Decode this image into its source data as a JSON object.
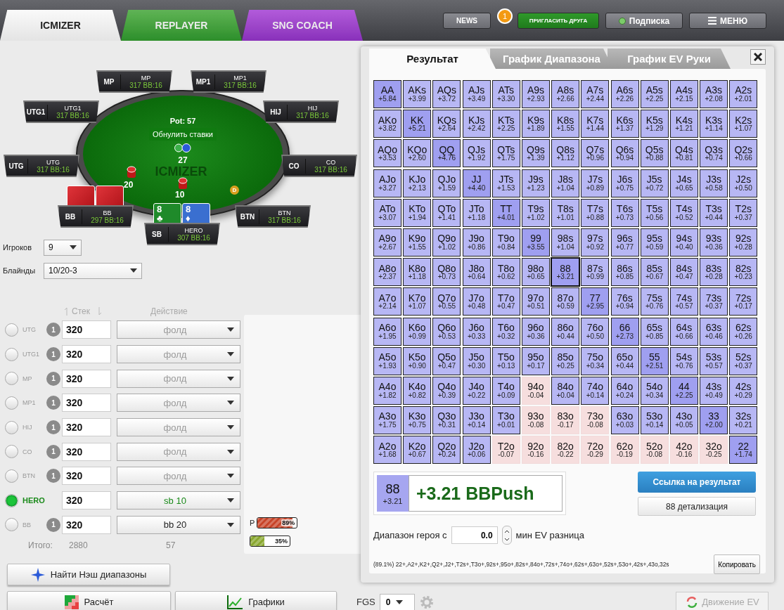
{
  "app_tabs": [
    {
      "label": "ICMIZER",
      "kind": "icmizer",
      "selected": true
    },
    {
      "label": "REPLAYER",
      "kind": "replayer",
      "selected": false
    },
    {
      "label": "SNG COACH",
      "kind": "coach",
      "selected": false
    }
  ],
  "top_buttons": [
    {
      "label": "NEWS",
      "kind": "plain"
    },
    {
      "label": "ПРИГЛАСИТЬ ДРУГА",
      "kind": "invite",
      "badge": "1"
    },
    {
      "label": "Подписка",
      "kind": "subscription"
    },
    {
      "label": "МЕНЮ",
      "kind": "menu"
    }
  ],
  "table": {
    "watermark": "ICMIZER",
    "pot": "Pot: 57",
    "reset_button": "Обнулить ставки",
    "pot_chips": "27",
    "dealer": "D",
    "seats": [
      {
        "position": "MP",
        "name": "MP",
        "stack": "317",
        "bb": "BB:16"
      },
      {
        "position": "MP1",
        "name": "MP1",
        "stack": "317",
        "bb": "BB:16"
      },
      {
        "position": "UTG1",
        "name": "UTG1",
        "stack": "317",
        "bb": "BB:16"
      },
      {
        "position": "HIJ",
        "name": "HIJ",
        "stack": "317",
        "bb": "BB:16"
      },
      {
        "position": "UTG",
        "name": "UTG",
        "stack": "317",
        "bb": "BB:16"
      },
      {
        "position": "CO",
        "name": "CO",
        "stack": "317",
        "bb": "BB:16"
      },
      {
        "position": "BB",
        "name": "BB",
        "stack": "297",
        "bb": "BB:16",
        "cards": [
          {
            "face_down": true
          },
          {
            "face_down": true
          }
        ],
        "bet": "20"
      },
      {
        "position": "SB",
        "name": "HERO",
        "stack": "307",
        "bb": "BB:16",
        "cards": [
          {
            "face_down": false,
            "rank": "8",
            "suit": "♣",
            "color": "#1f8a2a"
          },
          {
            "face_down": false,
            "rank": "8",
            "suit": "♦",
            "color": "#3a6fd0"
          }
        ],
        "bet": "10"
      },
      {
        "position": "BTN",
        "name": "BTN",
        "stack": "317",
        "bb": "BB:16"
      }
    ]
  },
  "settings": [
    {
      "label": "Игроков",
      "value": "9",
      "kind": "short"
    },
    {
      "label": "Блайнды",
      "value": "10/20-3",
      "kind": "wide"
    }
  ],
  "players_header": {
    "stack": "Стек",
    "action": "Действие"
  },
  "players": [
    {
      "position": "UTG",
      "selected": false,
      "count": "1",
      "stack": "320",
      "action": "фолд",
      "kind": "fold"
    },
    {
      "position": "UTG1",
      "selected": false,
      "count": "1",
      "stack": "320",
      "action": "фолд",
      "kind": "fold"
    },
    {
      "position": "MP",
      "selected": false,
      "count": "1",
      "stack": "320",
      "action": "фолд",
      "kind": "fold"
    },
    {
      "position": "MP1",
      "selected": false,
      "count": "1",
      "stack": "320",
      "action": "фолд",
      "kind": "fold"
    },
    {
      "position": "HIJ",
      "selected": false,
      "count": "1",
      "stack": "320",
      "action": "фолд",
      "kind": "fold"
    },
    {
      "position": "CO",
      "selected": false,
      "count": "1",
      "stack": "320",
      "action": "фолд",
      "kind": "fold"
    },
    {
      "position": "BTN",
      "selected": false,
      "count": "1",
      "stack": "320",
      "action": "фолд",
      "kind": "fold"
    },
    {
      "position": "HERO",
      "selected": true,
      "stack": "320",
      "action": "sb 10",
      "kind": "sb"
    },
    {
      "position": "BB",
      "selected": false,
      "count": "1",
      "stack": "320",
      "action": "bb 20",
      "kind": "bb"
    }
  ],
  "totals": {
    "label": "Итого:",
    "stack": "2880",
    "pot": "57"
  },
  "meters": [
    {
      "label": "P",
      "reading": "89%",
      "level": 0.89,
      "color": "#c8452a"
    },
    {
      "reading": "35%",
      "level": 0.35,
      "color": "#8aa830"
    }
  ],
  "nash_button": "Найти Нэш диапазоны",
  "bottom": {
    "calc": "Расчёт",
    "charts": "Графики",
    "fgs_label": "FGS",
    "fgs_value": "0",
    "ev_button": "Движение EV",
    "ev_disabled": true
  },
  "popup": {
    "tabs": [
      {
        "label": "Результат",
        "selected": true
      },
      {
        "label": "График Диапазона",
        "selected": false
      },
      {
        "label": "График EV Руки",
        "selected": false
      }
    ],
    "grid": [
      [
        {
          "hand": "AA",
          "ev": "+5.84",
          "push": true,
          "selected": false
        },
        {
          "hand": "AKs",
          "ev": "+3.99",
          "push": true,
          "selected": false
        },
        {
          "hand": "AQs",
          "ev": "+3.72",
          "push": true,
          "selected": false
        },
        {
          "hand": "AJs",
          "ev": "+3.49",
          "push": true,
          "selected": false
        },
        {
          "hand": "ATs",
          "ev": "+3.30",
          "push": true,
          "selected": false
        },
        {
          "hand": "A9s",
          "ev": "+2.93",
          "push": true,
          "selected": false
        },
        {
          "hand": "A8s",
          "ev": "+2.66",
          "push": true,
          "selected": false
        },
        {
          "hand": "A7s",
          "ev": "+2.44",
          "push": true,
          "selected": false
        },
        {
          "hand": "A6s",
          "ev": "+2.26",
          "push": true,
          "selected": false
        },
        {
          "hand": "A5s",
          "ev": "+2.25",
          "push": true,
          "selected": false
        },
        {
          "hand": "A4s",
          "ev": "+2.15",
          "push": true,
          "selected": false
        },
        {
          "hand": "A3s",
          "ev": "+2.08",
          "push": true,
          "selected": false
        },
        {
          "hand": "A2s",
          "ev": "+2.01",
          "push": true,
          "selected": false
        }
      ],
      [
        {
          "hand": "AKo",
          "ev": "+3.82",
          "push": true,
          "selected": false
        },
        {
          "hand": "KK",
          "ev": "+5.21",
          "push": true,
          "selected": false
        },
        {
          "hand": "KQs",
          "ev": "+2.64",
          "push": true,
          "selected": false
        },
        {
          "hand": "KJs",
          "ev": "+2.42",
          "push": true,
          "selected": false
        },
        {
          "hand": "KTs",
          "ev": "+2.25",
          "push": true,
          "selected": false
        },
        {
          "hand": "K9s",
          "ev": "+1.89",
          "push": true,
          "selected": false
        },
        {
          "hand": "K8s",
          "ev": "+1.55",
          "push": true,
          "selected": false
        },
        {
          "hand": "K7s",
          "ev": "+1.44",
          "push": true,
          "selected": false
        },
        {
          "hand": "K6s",
          "ev": "+1.37",
          "push": true,
          "selected": false
        },
        {
          "hand": "K5s",
          "ev": "+1.29",
          "push": true,
          "selected": false
        },
        {
          "hand": "K4s",
          "ev": "+1.21",
          "push": true,
          "selected": false
        },
        {
          "hand": "K3s",
          "ev": "+1.14",
          "push": true,
          "selected": false
        },
        {
          "hand": "K2s",
          "ev": "+1.07",
          "push": true,
          "selected": false
        }
      ],
      [
        {
          "hand": "AQo",
          "ev": "+3.53",
          "push": true,
          "selected": false
        },
        {
          "hand": "KQo",
          "ev": "+2.60",
          "push": true,
          "selected": false
        },
        {
          "hand": "QQ",
          "ev": "+4.76",
          "push": true,
          "selected": false
        },
        {
          "hand": "QJs",
          "ev": "+1.92",
          "push": true,
          "selected": false
        },
        {
          "hand": "QTs",
          "ev": "+1.75",
          "push": true,
          "selected": false
        },
        {
          "hand": "Q9s",
          "ev": "+1.39",
          "push": true,
          "selected": false
        },
        {
          "hand": "Q8s",
          "ev": "+1.12",
          "push": true,
          "selected": false
        },
        {
          "hand": "Q7s",
          "ev": "+0.96",
          "push": true,
          "selected": false
        },
        {
          "hand": "Q6s",
          "ev": "+0.94",
          "push": true,
          "selected": false
        },
        {
          "hand": "Q5s",
          "ev": "+0.88",
          "push": true,
          "selected": false
        },
        {
          "hand": "Q4s",
          "ev": "+0.81",
          "push": true,
          "selected": false
        },
        {
          "hand": "Q3s",
          "ev": "+0.74",
          "push": true,
          "selected": false
        },
        {
          "hand": "Q2s",
          "ev": "+0.66",
          "push": true,
          "selected": false
        }
      ],
      [
        {
          "hand": "AJo",
          "ev": "+3.27",
          "push": true,
          "selected": false
        },
        {
          "hand": "KJo",
          "ev": "+2.13",
          "push": true,
          "selected": false
        },
        {
          "hand": "QJo",
          "ev": "+1.59",
          "push": true,
          "selected": false
        },
        {
          "hand": "JJ",
          "ev": "+4.40",
          "push": true,
          "selected": false
        },
        {
          "hand": "JTs",
          "ev": "+1.53",
          "push": true,
          "selected": false
        },
        {
          "hand": "J9s",
          "ev": "+1.23",
          "push": true,
          "selected": false
        },
        {
          "hand": "J8s",
          "ev": "+1.04",
          "push": true,
          "selected": false
        },
        {
          "hand": "J7s",
          "ev": "+0.89",
          "push": true,
          "selected": false
        },
        {
          "hand": "J6s",
          "ev": "+0.75",
          "push": true,
          "selected": false
        },
        {
          "hand": "J5s",
          "ev": "+0.72",
          "push": true,
          "selected": false
        },
        {
          "hand": "J4s",
          "ev": "+0.65",
          "push": true,
          "selected": false
        },
        {
          "hand": "J3s",
          "ev": "+0.58",
          "push": true,
          "selected": false
        },
        {
          "hand": "J2s",
          "ev": "+0.50",
          "push": true,
          "selected": false
        }
      ],
      [
        {
          "hand": "ATo",
          "ev": "+3.07",
          "push": true,
          "selected": false
        },
        {
          "hand": "KTo",
          "ev": "+1.94",
          "push": true,
          "selected": false
        },
        {
          "hand": "QTo",
          "ev": "+1.41",
          "push": true,
          "selected": false
        },
        {
          "hand": "JTo",
          "ev": "+1.18",
          "push": true,
          "selected": false
        },
        {
          "hand": "TT",
          "ev": "+4.01",
          "push": true,
          "selected": false
        },
        {
          "hand": "T9s",
          "ev": "+1.02",
          "push": true,
          "selected": false
        },
        {
          "hand": "T8s",
          "ev": "+1.01",
          "push": true,
          "selected": false
        },
        {
          "hand": "T7s",
          "ev": "+0.88",
          "push": true,
          "selected": false
        },
        {
          "hand": "T6s",
          "ev": "+0.73",
          "push": true,
          "selected": false
        },
        {
          "hand": "T5s",
          "ev": "+0.56",
          "push": true,
          "selected": false
        },
        {
          "hand": "T4s",
          "ev": "+0.52",
          "push": true,
          "selected": false
        },
        {
          "hand": "T3s",
          "ev": "+0.44",
          "push": true,
          "selected": false
        },
        {
          "hand": "T2s",
          "ev": "+0.37",
          "push": true,
          "selected": false
        }
      ],
      [
        {
          "hand": "A9o",
          "ev": "+2.67",
          "push": true,
          "selected": false
        },
        {
          "hand": "K9o",
          "ev": "+1.55",
          "push": true,
          "selected": false
        },
        {
          "hand": "Q9o",
          "ev": "+1.02",
          "push": true,
          "selected": false
        },
        {
          "hand": "J9o",
          "ev": "+0.86",
          "push": true,
          "selected": false
        },
        {
          "hand": "T9o",
          "ev": "+0.84",
          "push": true,
          "selected": false
        },
        {
          "hand": "99",
          "ev": "+3.55",
          "push": true,
          "selected": false
        },
        {
          "hand": "98s",
          "ev": "+1.04",
          "push": true,
          "selected": false
        },
        {
          "hand": "97s",
          "ev": "+0.92",
          "push": true,
          "selected": false
        },
        {
          "hand": "96s",
          "ev": "+0.77",
          "push": true,
          "selected": false
        },
        {
          "hand": "95s",
          "ev": "+0.59",
          "push": true,
          "selected": false
        },
        {
          "hand": "94s",
          "ev": "+0.40",
          "push": true,
          "selected": false
        },
        {
          "hand": "93s",
          "ev": "+0.36",
          "push": true,
          "selected": false
        },
        {
          "hand": "92s",
          "ev": "+0.28",
          "push": true,
          "selected": false
        }
      ],
      [
        {
          "hand": "A8o",
          "ev": "+2.37",
          "push": true,
          "selected": false
        },
        {
          "hand": "K8o",
          "ev": "+1.18",
          "push": true,
          "selected": false
        },
        {
          "hand": "Q8o",
          "ev": "+0.73",
          "push": true,
          "selected": false
        },
        {
          "hand": "J8o",
          "ev": "+0.64",
          "push": true,
          "selected": false
        },
        {
          "hand": "T8o",
          "ev": "+0.62",
          "push": true,
          "selected": false
        },
        {
          "hand": "98o",
          "ev": "+0.65",
          "push": true,
          "selected": false
        },
        {
          "hand": "88",
          "ev": "+3.21",
          "push": true,
          "selected": true
        },
        {
          "hand": "87s",
          "ev": "+0.99",
          "push": true,
          "selected": false
        },
        {
          "hand": "86s",
          "ev": "+0.85",
          "push": true,
          "selected": false
        },
        {
          "hand": "85s",
          "ev": "+0.67",
          "push": true,
          "selected": false
        },
        {
          "hand": "84s",
          "ev": "+0.47",
          "push": true,
          "selected": false
        },
        {
          "hand": "83s",
          "ev": "+0.28",
          "push": true,
          "selected": false
        },
        {
          "hand": "82s",
          "ev": "+0.23",
          "push": true,
          "selected": false
        }
      ],
      [
        {
          "hand": "A7o",
          "ev": "+2.14",
          "push": true,
          "selected": false
        },
        {
          "hand": "K7o",
          "ev": "+1.07",
          "push": true,
          "selected": false
        },
        {
          "hand": "Q7o",
          "ev": "+0.55",
          "push": true,
          "selected": false
        },
        {
          "hand": "J7o",
          "ev": "+0.48",
          "push": true,
          "selected": false
        },
        {
          "hand": "T7o",
          "ev": "+0.47",
          "push": true,
          "selected": false
        },
        {
          "hand": "97o",
          "ev": "+0.51",
          "push": true,
          "selected": false
        },
        {
          "hand": "87o",
          "ev": "+0.59",
          "push": true,
          "selected": false
        },
        {
          "hand": "77",
          "ev": "+2.95",
          "push": true,
          "selected": false
        },
        {
          "hand": "76s",
          "ev": "+0.94",
          "push": true,
          "selected": false
        },
        {
          "hand": "75s",
          "ev": "+0.76",
          "push": true,
          "selected": false
        },
        {
          "hand": "74s",
          "ev": "+0.57",
          "push": true,
          "selected": false
        },
        {
          "hand": "73s",
          "ev": "+0.37",
          "push": true,
          "selected": false
        },
        {
          "hand": "72s",
          "ev": "+0.17",
          "push": true,
          "selected": false
        }
      ],
      [
        {
          "hand": "A6o",
          "ev": "+1.95",
          "push": true,
          "selected": false
        },
        {
          "hand": "K6o",
          "ev": "+0.99",
          "push": true,
          "selected": false
        },
        {
          "hand": "Q6o",
          "ev": "+0.53",
          "push": true,
          "selected": false
        },
        {
          "hand": "J6o",
          "ev": "+0.33",
          "push": true,
          "selected": false
        },
        {
          "hand": "T6o",
          "ev": "+0.32",
          "push": true,
          "selected": false
        },
        {
          "hand": "96o",
          "ev": "+0.36",
          "push": true,
          "selected": false
        },
        {
          "hand": "86o",
          "ev": "+0.44",
          "push": true,
          "selected": false
        },
        {
          "hand": "76o",
          "ev": "+0.50",
          "push": true,
          "selected": false
        },
        {
          "hand": "66",
          "ev": "+2.73",
          "push": true,
          "selected": false
        },
        {
          "hand": "65s",
          "ev": "+0.85",
          "push": true,
          "selected": false
        },
        {
          "hand": "64s",
          "ev": "+0.66",
          "push": true,
          "selected": false
        },
        {
          "hand": "63s",
          "ev": "+0.46",
          "push": true,
          "selected": false
        },
        {
          "hand": "62s",
          "ev": "+0.26",
          "push": true,
          "selected": false
        }
      ],
      [
        {
          "hand": "A5o",
          "ev": "+1.93",
          "push": true,
          "selected": false
        },
        {
          "hand": "K5o",
          "ev": "+0.90",
          "push": true,
          "selected": false
        },
        {
          "hand": "Q5o",
          "ev": "+0.47",
          "push": true,
          "selected": false
        },
        {
          "hand": "J5o",
          "ev": "+0.30",
          "push": true,
          "selected": false
        },
        {
          "hand": "T5o",
          "ev": "+0.13",
          "push": true,
          "selected": false
        },
        {
          "hand": "95o",
          "ev": "+0.17",
          "push": true,
          "selected": false
        },
        {
          "hand": "85o",
          "ev": "+0.25",
          "push": true,
          "selected": false
        },
        {
          "hand": "75o",
          "ev": "+0.34",
          "push": true,
          "selected": false
        },
        {
          "hand": "65o",
          "ev": "+0.44",
          "push": true,
          "selected": false
        },
        {
          "hand": "55",
          "ev": "+2.51",
          "push": true,
          "selected": false
        },
        {
          "hand": "54s",
          "ev": "+0.76",
          "push": true,
          "selected": false
        },
        {
          "hand": "53s",
          "ev": "+0.57",
          "push": true,
          "selected": false
        },
        {
          "hand": "52s",
          "ev": "+0.37",
          "push": true,
          "selected": false
        }
      ],
      [
        {
          "hand": "A4o",
          "ev": "+1.82",
          "push": true,
          "selected": false
        },
        {
          "hand": "K4o",
          "ev": "+0.82",
          "push": true,
          "selected": false
        },
        {
          "hand": "Q4o",
          "ev": "+0.39",
          "push": true,
          "selected": false
        },
        {
          "hand": "J4o",
          "ev": "+0.22",
          "push": true,
          "selected": false
        },
        {
          "hand": "T4o",
          "ev": "+0.09",
          "push": true,
          "selected": false
        },
        {
          "hand": "94o",
          "ev": "-0.04",
          "push": false,
          "selected": false
        },
        {
          "hand": "84o",
          "ev": "+0.04",
          "push": true,
          "selected": false
        },
        {
          "hand": "74o",
          "ev": "+0.14",
          "push": true,
          "selected": false
        },
        {
          "hand": "64o",
          "ev": "+0.24",
          "push": true,
          "selected": false
        },
        {
          "hand": "54o",
          "ev": "+0.34",
          "push": true,
          "selected": false
        },
        {
          "hand": "44",
          "ev": "+2.25",
          "push": true,
          "selected": false
        },
        {
          "hand": "43s",
          "ev": "+0.49",
          "push": true,
          "selected": false
        },
        {
          "hand": "42s",
          "ev": "+0.29",
          "push": true,
          "selected": false
        }
      ],
      [
        {
          "hand": "A3o",
          "ev": "+1.75",
          "push": true,
          "selected": false
        },
        {
          "hand": "K3o",
          "ev": "+0.75",
          "push": true,
          "selected": false
        },
        {
          "hand": "Q3o",
          "ev": "+0.31",
          "push": true,
          "selected": false
        },
        {
          "hand": "J3o",
          "ev": "+0.14",
          "push": true,
          "selected": false
        },
        {
          "hand": "T3o",
          "ev": "+0.01",
          "push": true,
          "selected": false
        },
        {
          "hand": "93o",
          "ev": "-0.08",
          "push": false,
          "selected": false
        },
        {
          "hand": "83o",
          "ev": "-0.17",
          "push": false,
          "selected": false
        },
        {
          "hand": "73o",
          "ev": "-0.08",
          "push": false,
          "selected": false
        },
        {
          "hand": "63o",
          "ev": "+0.03",
          "push": true,
          "selected": false
        },
        {
          "hand": "53o",
          "ev": "+0.14",
          "push": true,
          "selected": false
        },
        {
          "hand": "43o",
          "ev": "+0.05",
          "push": true,
          "selected": false
        },
        {
          "hand": "33",
          "ev": "+2.00",
          "push": true,
          "selected": false
        },
        {
          "hand": "32s",
          "ev": "+0.21",
          "push": true,
          "selected": false
        }
      ],
      [
        {
          "hand": "A2o",
          "ev": "+1.68",
          "push": true,
          "selected": false
        },
        {
          "hand": "K2o",
          "ev": "+0.67",
          "push": true,
          "selected": false
        },
        {
          "hand": "Q2o",
          "ev": "+0.24",
          "push": true,
          "selected": false
        },
        {
          "hand": "J2o",
          "ev": "+0.06",
          "push": true,
          "selected": false
        },
        {
          "hand": "T2o",
          "ev": "-0.07",
          "push": false,
          "selected": false
        },
        {
          "hand": "92o",
          "ev": "-0.16",
          "push": false,
          "selected": false
        },
        {
          "hand": "82o",
          "ev": "-0.22",
          "push": false,
          "selected": false
        },
        {
          "hand": "72o",
          "ev": "-0.29",
          "push": false,
          "selected": false
        },
        {
          "hand": "62o",
          "ev": "-0.19",
          "push": false,
          "selected": false
        },
        {
          "hand": "52o",
          "ev": "-0.08",
          "push": false,
          "selected": false
        },
        {
          "hand": "42o",
          "ev": "-0.16",
          "push": false,
          "selected": false
        },
        {
          "hand": "32o",
          "ev": "-0.25",
          "push": false,
          "selected": false
        },
        {
          "hand": "22",
          "ev": "+1.74",
          "push": true,
          "selected": false
        }
      ]
    ],
    "result": {
      "hand": "88",
      "ev": "+3.21",
      "push": true,
      "summary": "+3.21 BBPush"
    },
    "link_button": "Ссылка на результат",
    "detail_button": "88 детализация",
    "filter": {
      "label": "Диапазон героя с",
      "value": "0.0",
      "suffix": "мин EV разница"
    },
    "range_text": "(89.1%) 22+,A2+,K2+,Q2+,J2+,T2s+,T3o+,92s+,95o+,82s+,84o+,72s+,74o+,62s+,63o+,52s+,53o+,42s+,43o,32s",
    "copy_button": "Копировать"
  }
}
